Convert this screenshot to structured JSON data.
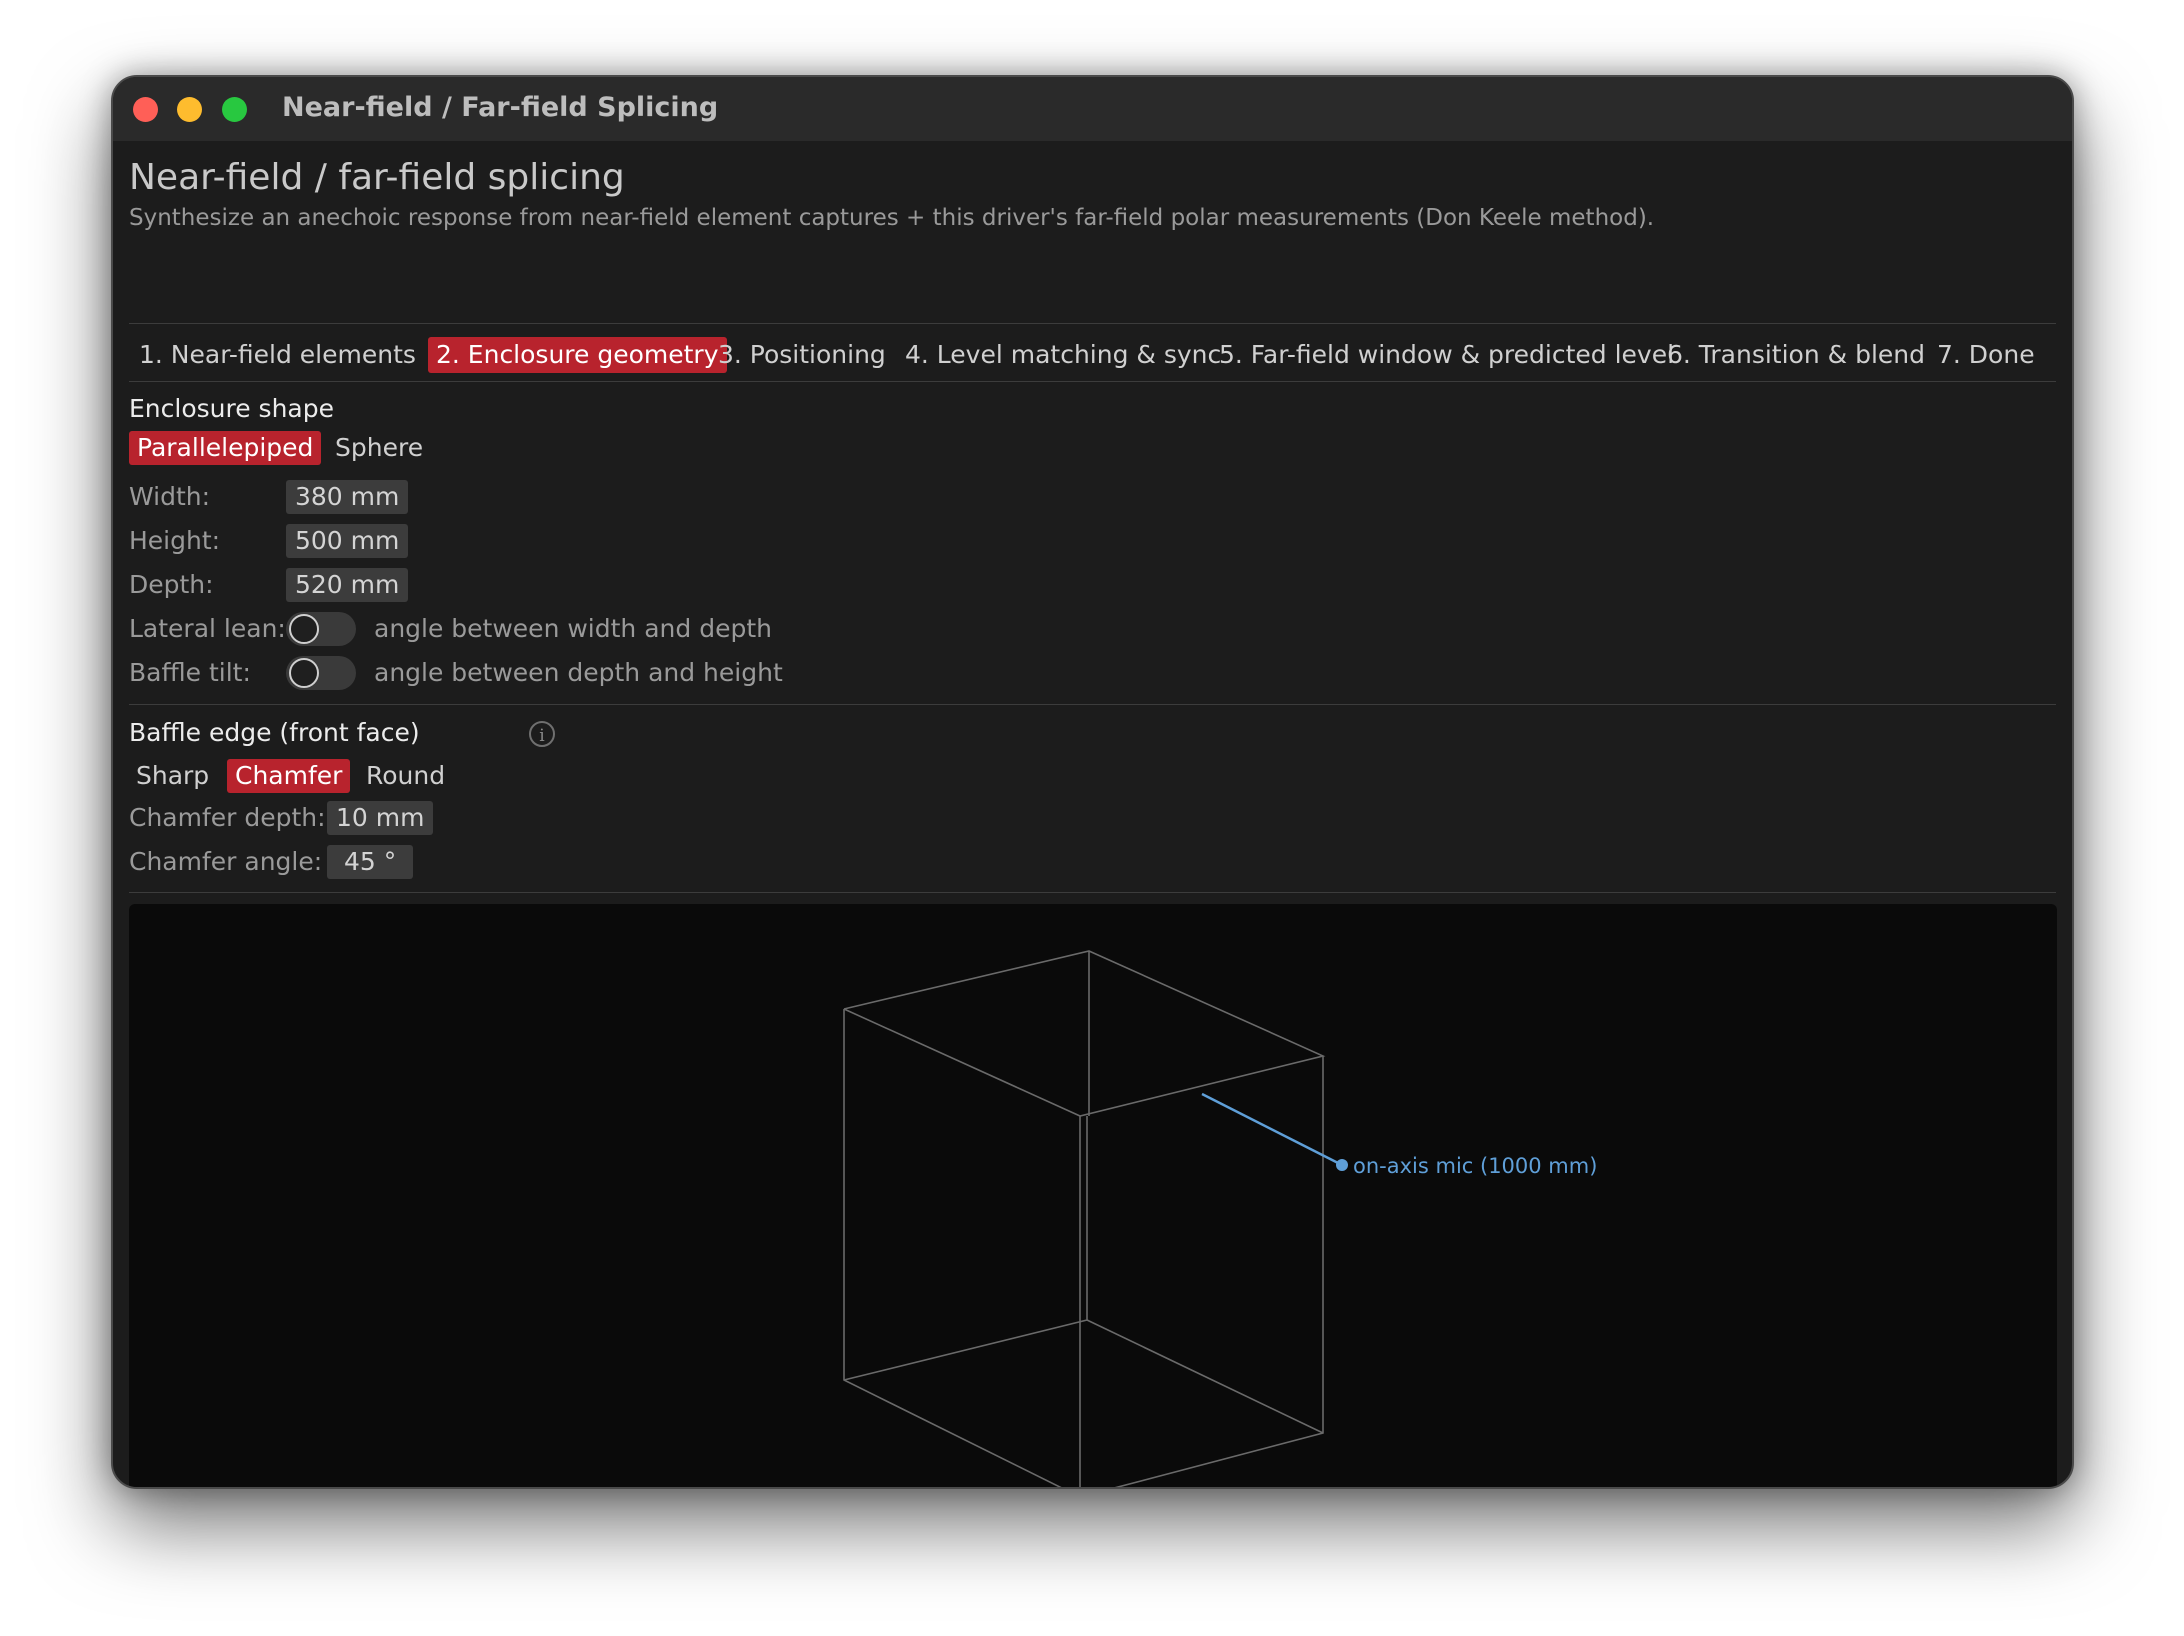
{
  "window": {
    "title": "Near-field / Far-field Splicing"
  },
  "page": {
    "title": "Near-field / far-field splicing",
    "subtitle": "Synthesize an anechoic response from near-field element captures + this driver's far-field polar measurements (Don Keele method)."
  },
  "tabs": [
    {
      "label": "1. Near-field elements",
      "active": false
    },
    {
      "label": "2. Enclosure geometry",
      "active": true
    },
    {
      "label": "3. Positioning",
      "active": false
    },
    {
      "label": "4. Level matching & sync",
      "active": false
    },
    {
      "label": "5. Far-field window & predicted level",
      "active": false
    },
    {
      "label": "6. Transition & blend",
      "active": false
    },
    {
      "label": "7. Done",
      "active": false
    }
  ],
  "enclosure": {
    "section_title": "Enclosure shape",
    "shapes": [
      {
        "label": "Parallelepiped",
        "active": true
      },
      {
        "label": "Sphere",
        "active": false
      }
    ],
    "width": {
      "label": "Width:",
      "value": "380 mm"
    },
    "height": {
      "label": "Height:",
      "value": "500 mm"
    },
    "depth": {
      "label": "Depth:",
      "value": "520 mm"
    },
    "lateral_lean": {
      "label": "Lateral lean:",
      "enabled": false,
      "hint": "angle between width and depth"
    },
    "baffle_tilt": {
      "label": "Baffle tilt:",
      "enabled": false,
      "hint": "angle between depth and height"
    }
  },
  "baffle_edge": {
    "section_title": "Baffle edge (front face)",
    "info_icon": "info-icon",
    "options": [
      {
        "label": "Sharp",
        "active": false
      },
      {
        "label": "Chamfer",
        "active": true
      },
      {
        "label": "Round",
        "active": false
      }
    ],
    "chamfer_depth": {
      "label": "Chamfer depth:",
      "value": "10 mm"
    },
    "chamfer_angle": {
      "label": "Chamfer angle:",
      "value": "45 °"
    }
  },
  "viewport": {
    "mic_label": "on-axis mic (1000 mm)",
    "mic_color": "#5f9fd8",
    "edge_color": "#6a6a6a"
  },
  "colors": {
    "accent": "#b8232d",
    "background": "#1c1c1c",
    "titlebar": "#2a2a2a",
    "viewport": "#0a0a0a"
  }
}
